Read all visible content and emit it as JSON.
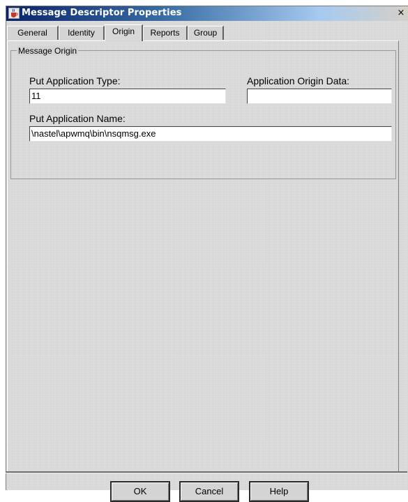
{
  "window": {
    "title": "Message Descriptor Properties",
    "close_symbol": "×",
    "icon": "java-cup-icon"
  },
  "tabs": [
    {
      "label": "General"
    },
    {
      "label": "Identity"
    },
    {
      "label": "Origin"
    },
    {
      "label": "Reports"
    },
    {
      "label": "Group"
    }
  ],
  "active_tab": "Origin",
  "group": {
    "legend": "Message Origin",
    "put_application_type": {
      "label": "Put Application Type:",
      "value": "11"
    },
    "application_origin_data": {
      "label": "Application Origin Data:",
      "value": ""
    },
    "put_application_name": {
      "label": "Put Application Name:",
      "value": "\\nastel\\apwmq\\bin\\nsqmsg.exe"
    }
  },
  "buttons": {
    "ok": "OK",
    "cancel": "Cancel",
    "help": "Help"
  },
  "colors": {
    "title_gradient_start": "#0a246a",
    "title_gradient_end": "#d4d0c8",
    "dialog_background": "#d4d4d4"
  }
}
